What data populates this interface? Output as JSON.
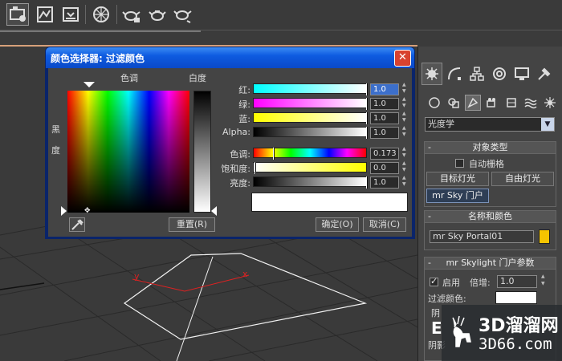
{
  "dialog": {
    "title": "颜色选择器: 过滤颜色",
    "hue_label": "色调",
    "whiteness_label": "白度",
    "blackness_label_1": "黑",
    "blackness_label_2": "度",
    "sliders": [
      {
        "label": "红:",
        "value": "1.0"
      },
      {
        "label": "绿:",
        "value": "1.0"
      },
      {
        "label": "蓝:",
        "value": "1.0"
      },
      {
        "label": "Alpha:",
        "value": "1.0"
      },
      {
        "label": "色调:",
        "value": "0.173"
      },
      {
        "label": "饱和度:",
        "value": "0.0"
      },
      {
        "label": "亮度:",
        "value": "1.0"
      }
    ],
    "reset_button": "重置(R)",
    "ok_button": "确定(O)",
    "cancel_button": "取消(C)",
    "preview_color": "#ffffff"
  },
  "command_panel": {
    "dropdown_value": "光度学",
    "object_type_title": "对象类型",
    "auto_grid_label": "自动栅格",
    "buttons": [
      "目标灯光",
      "自由灯光",
      "mr Sky 门户"
    ],
    "name_color_title": "名称和颜色",
    "object_name": "mr Sky Portal01",
    "object_color": "#f5c400",
    "params_title": "mr Skylight 门户参数",
    "enable_label": "启用",
    "multiplier_label": "倍增:",
    "multiplier_value": "1.0",
    "filter_color_label": "过滤颜色:",
    "cut_text_1": "阴",
    "cut_text_2": "阴影",
    "cut_text_3": "E"
  },
  "viewport": {
    "axis_x": "x",
    "axis_y": "y"
  },
  "watermark": {
    "brand": "3D溜溜网",
    "url": "3D66.com"
  }
}
